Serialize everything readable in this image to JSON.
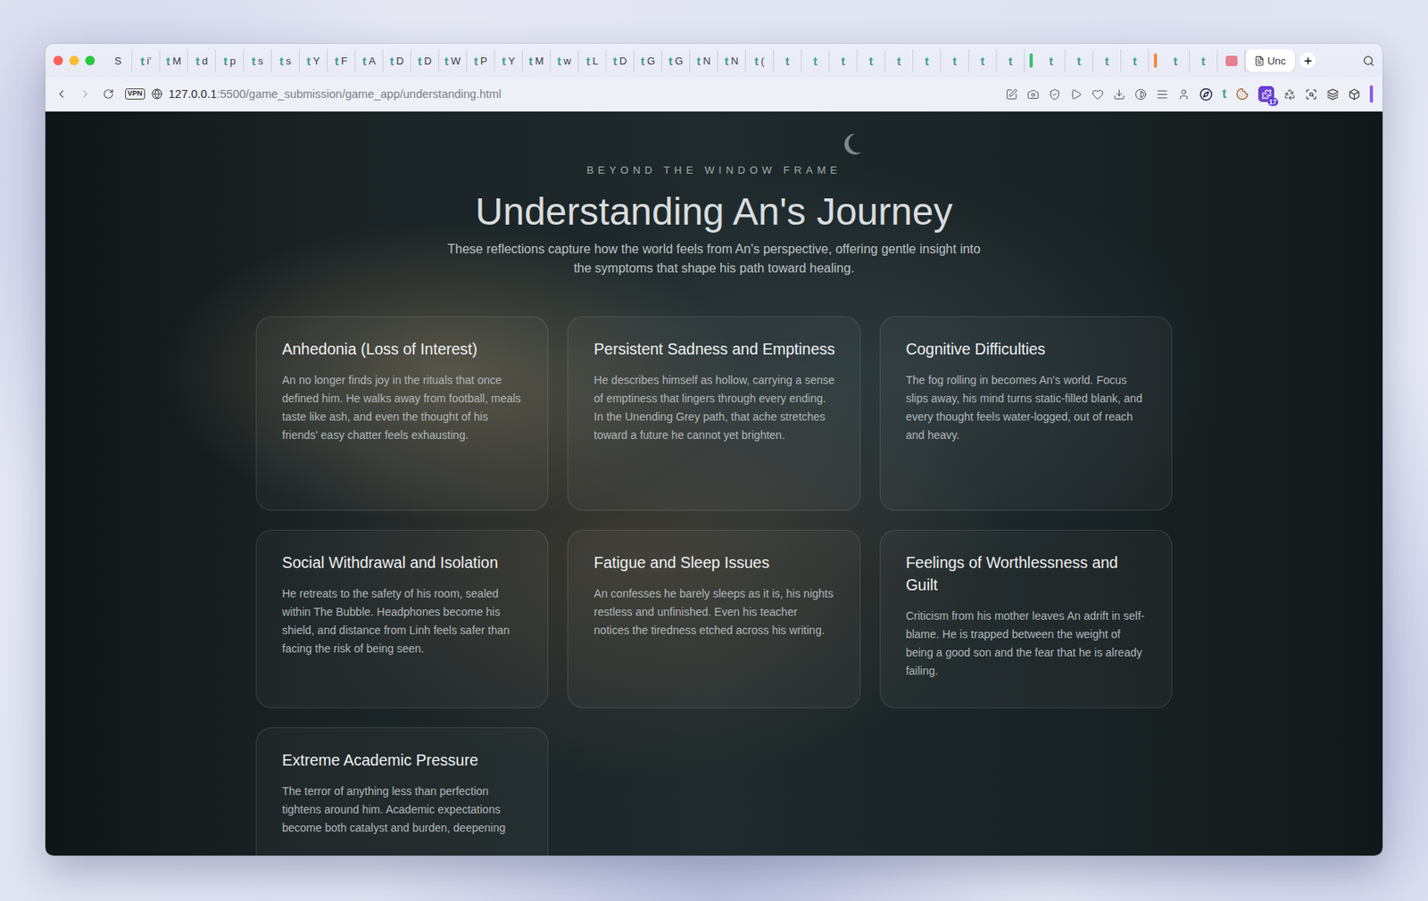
{
  "browser": {
    "tabs": [
      {
        "kind": "label",
        "label": "S",
        "selected": false
      },
      {
        "kind": "favicon",
        "icon": "t",
        "label": "i'",
        "selected": false
      },
      {
        "kind": "favicon",
        "icon": "t",
        "label": "M",
        "selected": false
      },
      {
        "kind": "favicon",
        "icon": "t",
        "label": "d",
        "selected": false
      },
      {
        "kind": "favicon",
        "icon": "t",
        "label": "p",
        "selected": false
      },
      {
        "kind": "favicon",
        "icon": "t",
        "label": "s",
        "selected": false
      },
      {
        "kind": "favicon",
        "icon": "t",
        "label": "s",
        "selected": false
      },
      {
        "kind": "favicon",
        "icon": "t",
        "label": "Y",
        "selected": false
      },
      {
        "kind": "favicon",
        "icon": "t",
        "label": "F",
        "selected": false
      },
      {
        "kind": "favicon",
        "icon": "t",
        "label": "A",
        "selected": false
      },
      {
        "kind": "favicon",
        "icon": "t",
        "label": "D",
        "selected": false
      },
      {
        "kind": "favicon",
        "icon": "t",
        "label": "D",
        "selected": false
      },
      {
        "kind": "favicon",
        "icon": "t",
        "label": "W",
        "selected": false
      },
      {
        "kind": "favicon",
        "icon": "t",
        "label": "P",
        "selected": false
      },
      {
        "kind": "favicon",
        "icon": "t",
        "label": "Y",
        "selected": false
      },
      {
        "kind": "favicon",
        "icon": "t",
        "label": "M",
        "selected": false
      },
      {
        "kind": "favicon",
        "icon": "t",
        "label": "w",
        "selected": false
      },
      {
        "kind": "favicon",
        "icon": "t",
        "label": "L",
        "selected": false
      },
      {
        "kind": "favicon",
        "icon": "t",
        "label": "D",
        "selected": false
      },
      {
        "kind": "favicon",
        "icon": "t",
        "label": "G",
        "selected": false
      },
      {
        "kind": "favicon",
        "icon": "t",
        "label": "G",
        "selected": false
      },
      {
        "kind": "favicon",
        "icon": "t",
        "label": "N",
        "selected": false
      },
      {
        "kind": "favicon",
        "icon": "t",
        "label": "N",
        "selected": false
      },
      {
        "kind": "favicon",
        "icon": "t",
        "label": "(",
        "selected": false
      },
      {
        "kind": "icon",
        "icon": "t",
        "selected": false
      },
      {
        "kind": "icon",
        "icon": "t",
        "selected": false
      },
      {
        "kind": "icon",
        "icon": "t",
        "selected": false
      },
      {
        "kind": "icon",
        "icon": "t",
        "selected": false
      },
      {
        "kind": "icon",
        "icon": "t",
        "selected": false
      },
      {
        "kind": "icon",
        "icon": "t",
        "selected": false
      },
      {
        "kind": "icon",
        "icon": "t",
        "selected": false
      },
      {
        "kind": "icon",
        "icon": "t",
        "selected": false
      },
      {
        "kind": "icon",
        "icon": "t",
        "selected": false
      },
      {
        "kind": "group",
        "color": "#34c26a"
      },
      {
        "kind": "icon",
        "icon": "t",
        "selected": false
      },
      {
        "kind": "icon",
        "icon": "t",
        "selected": false
      },
      {
        "kind": "icon",
        "icon": "t",
        "selected": false
      },
      {
        "kind": "icon",
        "icon": "t",
        "selected": false
      },
      {
        "kind": "group",
        "color": "#f08a3c"
      },
      {
        "kind": "icon",
        "icon": "t",
        "selected": false
      },
      {
        "kind": "icon",
        "icon": "t",
        "selected": false
      },
      {
        "kind": "image",
        "color": "#e7808f",
        "selected": false
      },
      {
        "kind": "page",
        "label": "Unc",
        "selected": true
      }
    ],
    "address": {
      "vpn": "VPN",
      "host": "127.0.0.1",
      "path": ":5500/game_submission/game_app/understanding.html"
    },
    "extension_letter": "t",
    "extension_badge": "17"
  },
  "page": {
    "eyebrow": "BEYOND THE WINDOW FRAME",
    "title": "Understanding An's Journey",
    "subtitle": "These reflections capture how the world feels from An's perspective, offering gentle insight into the symptoms that shape his path toward healing.",
    "cards": [
      {
        "title": "Anhedonia (Loss of Interest)",
        "body": "An no longer finds joy in the rituals that once defined him. He walks away from football, meals taste like ash, and even the thought of his friends' easy chatter feels exhausting."
      },
      {
        "title": "Persistent Sadness and Emptiness",
        "body": "He describes himself as hollow, carrying a sense of emptiness that lingers through every ending. In the Unending Grey path, that ache stretches toward a future he cannot yet brighten."
      },
      {
        "title": "Cognitive Difficulties",
        "body": "The fog rolling in becomes An's world. Focus slips away, his mind turns static-filled blank, and every thought feels water-logged, out of reach and heavy."
      },
      {
        "title": "Social Withdrawal and Isolation",
        "body": "He retreats to the safety of his room, sealed within The Bubble. Headphones become his shield, and distance from Linh feels safer than facing the risk of being seen."
      },
      {
        "title": "Fatigue and Sleep Issues",
        "body": "An confesses he barely sleeps as it is, his nights restless and unfinished. Even his teacher notices the tiredness etched across his writing."
      },
      {
        "title": "Feelings of Worthlessness and Guilt",
        "body": "Criticism from his mother leaves An adrift in self-blame. He is trapped between the weight of being a good son and the fear that he is already failing."
      },
      {
        "title": "Extreme Academic Pressure",
        "body": "The terror of anything less than perfection tightens around him. Academic expectations become both catalyst and burden, deepening"
      }
    ]
  }
}
